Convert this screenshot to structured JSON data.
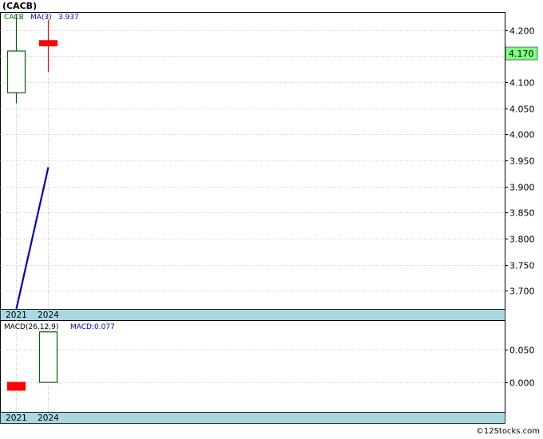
{
  "title": "(CACB)",
  "footer": "©12Stocks.com",
  "colors": {
    "up": "#006400",
    "down": "#ff0000",
    "ma_line": "#0000cc",
    "label_bar": "#a8d8e0",
    "price_tag": "#80ff80",
    "grid": "#999999",
    "frame": "#000000"
  },
  "chart_data": [
    {
      "type": "candlestick",
      "legend": {
        "symbol": "CACB",
        "ma_label": "MA(3)",
        "ma_value": "3.937"
      },
      "categories": [
        "2021",
        "2024"
      ],
      "ohlc": [
        {
          "open": 4.08,
          "high": 4.23,
          "low": 4.06,
          "close": 4.16
        },
        {
          "open": 4.18,
          "high": 4.22,
          "low": 4.12,
          "close": 4.17
        }
      ],
      "ma_series": {
        "name": "MA(3)",
        "values": [
          3.665,
          3.937
        ]
      },
      "yticks": [
        3.7,
        3.75,
        3.8,
        3.85,
        3.9,
        3.95,
        4.0,
        4.05,
        4.1,
        4.15,
        4.2
      ],
      "ytick_labels": [
        "3.700",
        "3.750",
        "3.800",
        "3.850",
        "3.900",
        "3.950",
        "4.000",
        "4.050",
        "4.100",
        "4.150",
        "4.200"
      ],
      "ylim": [
        3.665,
        4.235
      ],
      "last_price": "4.170",
      "grid": true
    },
    {
      "type": "bar",
      "legend": {
        "label": "MACD(26,12,9)",
        "value_label": "MACD:0.077"
      },
      "categories": [
        "2021",
        "2024"
      ],
      "values": [
        -0.012,
        0.077
      ],
      "yticks": [
        0.0,
        0.05
      ],
      "ytick_labels": [
        "0.000",
        "0.050"
      ],
      "ylim": [
        -0.045,
        0.095
      ],
      "grid": true
    }
  ]
}
